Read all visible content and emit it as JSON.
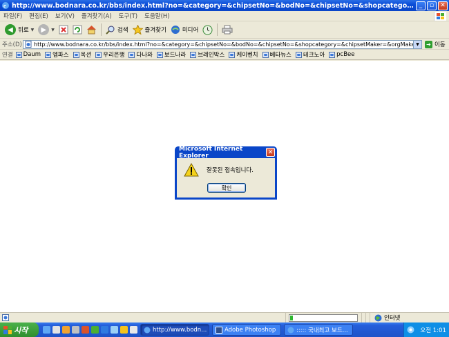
{
  "window": {
    "title": "http://www.bodnara.co.kr/bbs/index.html?no=&category=&chipsetNo=&bodNo=&chipsetNo=&shopcategory - Microsoft Internet ..."
  },
  "menu": [
    "파일(F)",
    "편집(E)",
    "보기(V)",
    "즐겨찾기(A)",
    "도구(T)",
    "도움말(H)"
  ],
  "toolbar": {
    "back": "뒤로",
    "search": "검색",
    "favorites": "즐겨찾기",
    "media": "미디어"
  },
  "address": {
    "label": "주소(D)",
    "url": "http://www.bodnara.co.kr/bbs/index.html?no=&category=&chipsetNo=&bodNo=&chipsetNo=&shopcategory=&chipsetMaker=&orgMaker=&no=",
    "go": "이동"
  },
  "links": {
    "label": "연결",
    "items": [
      "Daum",
      "엠파스",
      "옥션",
      "우리은행",
      "다나와",
      "보드나라",
      "브레인박스",
      "케이벤치",
      "베타뉴스",
      "테크노아",
      "pcBee"
    ]
  },
  "dialog": {
    "title": "Microsoft Internet Explorer",
    "message": "잘못된 접속입니다.",
    "ok": "확인"
  },
  "status": {
    "zone": "인터넷",
    "progress": 0.04
  },
  "taskbar": {
    "start": "시작",
    "tasks": [
      "http://www.bodn...",
      "Adobe Photoshop",
      "::::: 국내최고 보드..."
    ],
    "time": "오전 1:01"
  },
  "colors": {
    "titlebar": "#0b4dd8",
    "taskbar": "#245edb",
    "start": "#2e8f2e"
  }
}
